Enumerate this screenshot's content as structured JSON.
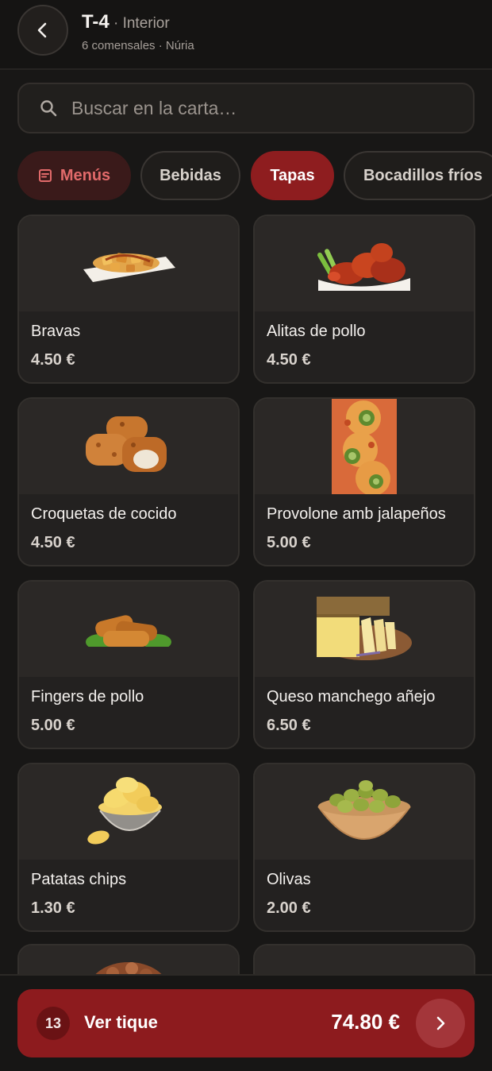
{
  "header": {
    "table": "T-4",
    "zone": " · Interior",
    "subtitle": "6 comensales · Núria",
    "back_icon": "chevron-left-icon"
  },
  "search": {
    "placeholder": "Buscar en la carta…",
    "icon": "search-icon"
  },
  "tabs": [
    {
      "label": "Menús",
      "icon": "menu-icon",
      "state": "special"
    },
    {
      "label": "Bebidas",
      "state": "normal"
    },
    {
      "label": "Tapas",
      "state": "active"
    },
    {
      "label": "Bocadillos fríos",
      "state": "normal"
    }
  ],
  "products": [
    {
      "name": "Bravas",
      "price": "4.50 €",
      "image": "bravas-image"
    },
    {
      "name": "Alitas de pollo",
      "price": "4.50 €",
      "image": "chicken-wings-image"
    },
    {
      "name": "Croquetas de cocido",
      "price": "4.50 €",
      "image": "croquetas-image"
    },
    {
      "name": "Provolone amb jalapeños",
      "price": "5.00 €",
      "image": "provolone-image"
    },
    {
      "name": "Fingers de pollo",
      "price": "5.00 €",
      "image": "chicken-fingers-image"
    },
    {
      "name": "Queso manchego añejo",
      "price": "6.50 €",
      "image": "cheese-image"
    },
    {
      "name": "Patatas chips",
      "price": "1.30 €",
      "image": "chips-image"
    },
    {
      "name": "Olivas",
      "price": "2.00 €",
      "image": "olives-image"
    },
    {
      "name": "",
      "price": "",
      "image": "meat-image"
    },
    {
      "name": "",
      "price": "",
      "image": ""
    }
  ],
  "ticket": {
    "count": "13",
    "label": "Ver tique",
    "total": "74.80 €",
    "go_icon": "chevron-right-icon"
  },
  "colors": {
    "accent": "#8d1b1e",
    "background": "#181716",
    "card": "#232120"
  }
}
